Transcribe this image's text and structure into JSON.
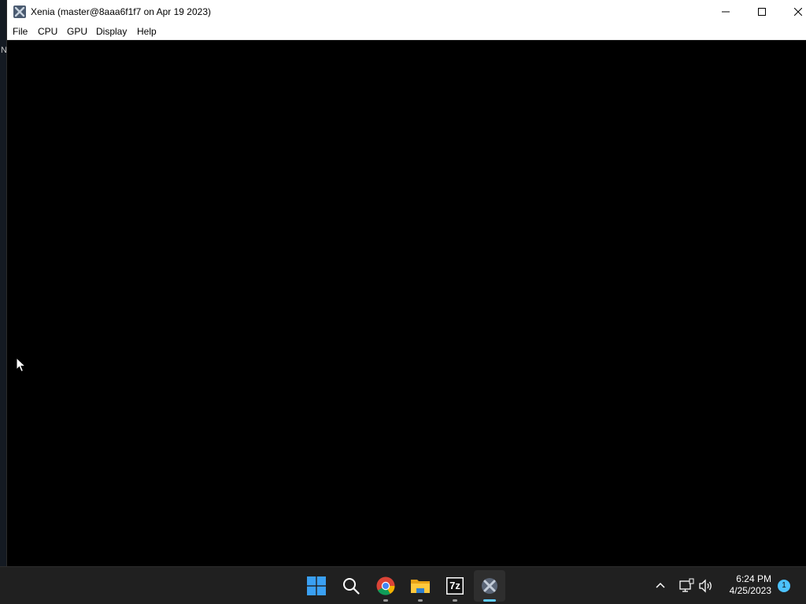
{
  "desktop": {
    "edge_letter": "N"
  },
  "window": {
    "title": "Xenia (master@8aaa6f1f7 on Apr 19 2023)",
    "app_icon": "xenia-icon",
    "controls": [
      "minimize-icon",
      "maximize-icon",
      "close-icon"
    ]
  },
  "menu": {
    "file": "File",
    "cpu": "CPU",
    "gpu": "GPU",
    "display": "Display",
    "help": "Help"
  },
  "taskbar": {
    "apps": [
      "windows-start-icon",
      "search-icon",
      "chrome-icon",
      "file-explorer-icon",
      "7zip-icon",
      "xenia-icon"
    ],
    "seven_zip_label": "7z",
    "tray_icons": [
      "chevron-up-icon",
      "network-icon",
      "volume-icon"
    ],
    "time": "6:24 PM",
    "date": "4/25/2023",
    "notification_count": "1",
    "accent_color": "#60cdff"
  }
}
